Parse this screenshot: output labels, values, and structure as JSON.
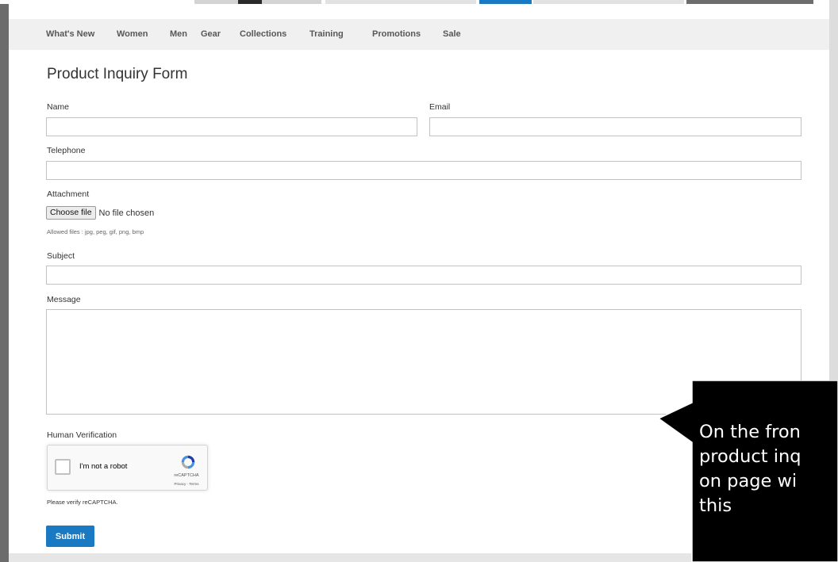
{
  "nav": {
    "items": [
      "What's New",
      "Women",
      "Men",
      "Gear",
      "Collections",
      "Training",
      "Promotions",
      "Sale"
    ]
  },
  "form": {
    "title": "Product Inquiry Form",
    "name_label": "Name",
    "email_label": "Email",
    "telephone_label": "Telephone",
    "attachment_label": "Attachment",
    "choose_file_label": "Choose file",
    "no_file_text": "No file chosen",
    "allowed_files_hint": "Allowed files : jpg, peg, gif, png, bmp",
    "subject_label": "Subject",
    "message_label": "Message",
    "human_verification_label": "Human Verification",
    "captcha_text": "I'm not a robot",
    "captcha_brand": "reCAPTCHA",
    "captcha_links": "Privacy - Terms",
    "verify_message": "Please verify reCAPTCHA.",
    "submit_label": "Submit"
  },
  "callout": {
    "lines": [
      "On the fron",
      "product inq",
      "on page  wi",
      "this"
    ]
  },
  "colors": {
    "accent": "#1979c3",
    "nav_background": "#f0f0f0",
    "callout_background": "#000000"
  }
}
